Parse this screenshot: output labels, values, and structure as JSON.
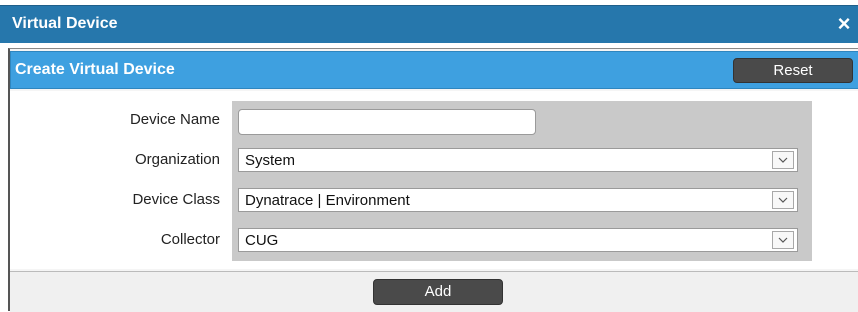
{
  "window": {
    "title": "Virtual Device",
    "close_icon": "×"
  },
  "panel": {
    "title": "Create Virtual Device",
    "reset_label": "Reset"
  },
  "form": {
    "device_name": {
      "label": "Device Name",
      "value": ""
    },
    "organization": {
      "label": "Organization",
      "value": "System"
    },
    "device_class": {
      "label": "Device Class",
      "value": "Dynatrace | Environment"
    },
    "collector": {
      "label": "Collector",
      "value": "CUG"
    }
  },
  "footer": {
    "add_label": "Add"
  },
  "colors": {
    "titlebar": "#2677ac",
    "panel_header": "#3ea0e0",
    "button": "#4a4a4a",
    "field_bg": "#c9c9c9"
  }
}
